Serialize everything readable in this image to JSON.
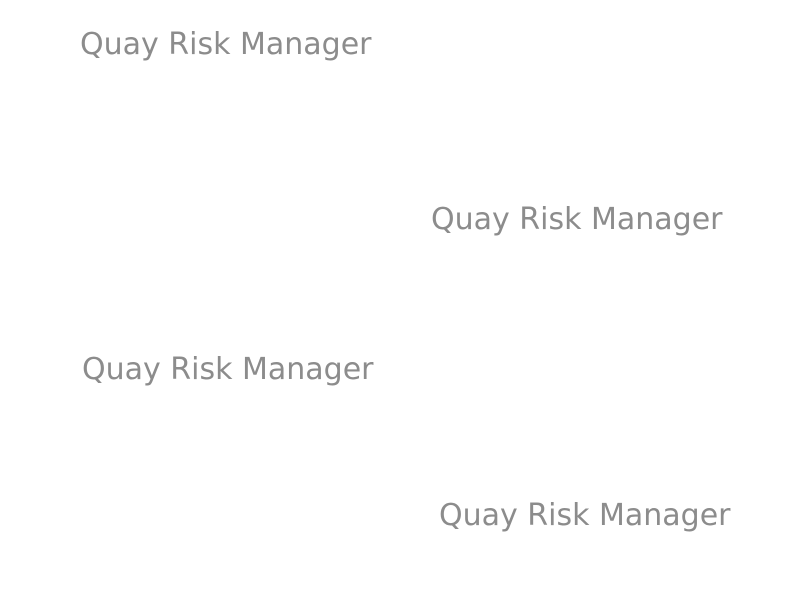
{
  "watermark": {
    "text": "Quay Risk Manager",
    "color": "#8c8c8c",
    "instances": [
      {
        "text": "Quay Risk Manager"
      },
      {
        "text": "Quay Risk Manager"
      },
      {
        "text": "Quay Risk Manager"
      },
      {
        "text": "Quay Risk Manager"
      }
    ]
  }
}
